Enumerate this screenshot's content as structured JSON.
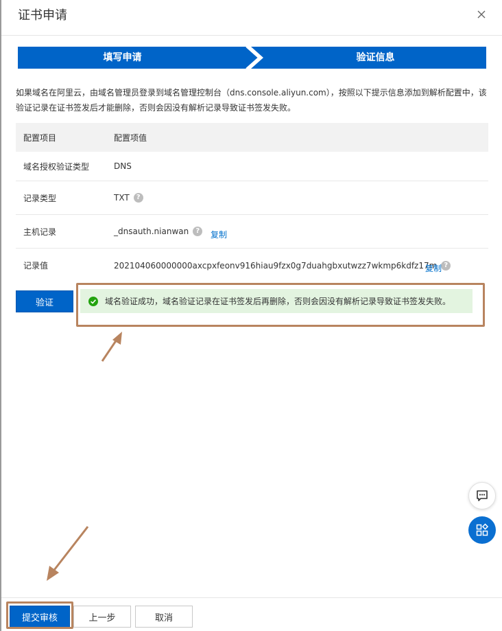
{
  "dialog": {
    "title": "证书申请",
    "close_icon": "close-icon"
  },
  "steps": [
    {
      "label": "填写申请",
      "state": "done"
    },
    {
      "label": "验证信息",
      "state": "active"
    }
  ],
  "notice": "如果域名在阿里云，由域名管理员登录到域名管理控制台（dns.console.aliyun.com），按照以下提示信息添加到解析配置中，该验证记录在证书签发后才能删除，否则会因没有解析记录导致证书签发失败。",
  "table": {
    "headers": {
      "key": "配置项目",
      "value": "配置项值"
    },
    "rows": [
      {
        "key": "域名授权验证类型",
        "value": "DNS"
      },
      {
        "key": "记录类型",
        "value": "TXT"
      },
      {
        "key": "主机记录",
        "value": "_dnsauth.nianwan",
        "copy": "复制"
      },
      {
        "key": "记录值",
        "value": "202104060000000axcpxfeonv916hiau9fzx0g7duahgbxutwzz7wkmp6kdfz17m",
        "copy": "复制"
      }
    ]
  },
  "verify_button": "验证",
  "success_message": "域名验证成功，域名验证记录在证书签发后再删除，否则会因没有解析记录导致证书签发失败。",
  "footer": {
    "submit": "提交审核",
    "prev": "上一步",
    "cancel": "取消"
  },
  "colors": {
    "primary": "#0064c8",
    "success_bg": "#e3f4e0",
    "success_icon": "#23a30f",
    "annotation": "#b8845f",
    "link": "#0070cc"
  },
  "icons": {
    "help": "question-circle-icon",
    "success": "check-circle-icon",
    "chat": "chat-bubble-icon",
    "apps": "apps-grid-icon"
  }
}
